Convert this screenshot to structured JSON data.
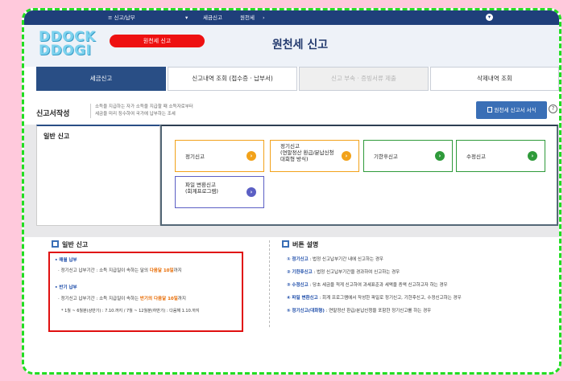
{
  "nav": {
    "menu": "≡ 신고/납부",
    "crumb1": "세금신고",
    "crumb2": "원천세"
  },
  "header": {
    "logo_line1": "DDOCK",
    "logo_line2": "DDOGI",
    "badge": "원천세 신고",
    "title": "원천세 신고"
  },
  "tabs": [
    {
      "label": "세금신고"
    },
    {
      "label": "신고내역 조회 (접수증 · 납부서)"
    },
    {
      "label": "신고 부속 · 증빙서류 제출"
    },
    {
      "label": "삭제내역 조회"
    }
  ],
  "section": {
    "title": "신고서작성",
    "desc1": "소득을 지급하는 자가 소득을 지급할 때 소득자로부터",
    "desc2": "세금을 미리 징수하여 국가에 납부하는 조세",
    "form_button": "원천세 신고서 서식"
  },
  "normal_box": {
    "title": "일반 신고"
  },
  "cards": [
    {
      "label": "정기신고"
    },
    {
      "label_line1": "정기신고",
      "label_line2": "(연말정산 환급/분납신청",
      "label_line3": "대회형 방식)"
    },
    {
      "label": "기한후신고"
    },
    {
      "label": "수정신고"
    },
    {
      "label_line1": "파일 변환신고",
      "label_line2": "(회계프로그램)"
    }
  ],
  "info_left": {
    "heading": "일반 신고",
    "monthly_title": "• 매월 납부",
    "monthly_prefix": "· 정기신고 납부기간 : 소득 지급일이 속하는 달의 ",
    "monthly_highlight": "다음달 10일",
    "monthly_suffix": "까지",
    "half_title": "• 반기 납부",
    "half_prefix": "· 정기신고 납부기간 : 소득 지급일이 속하는 ",
    "half_highlight": "반기의 다음달 10일",
    "half_suffix": "까지",
    "half_note": "* 1월 ~ 6월분(상반기) : 7.10.까지 / 7월 ~ 12월분(하반기) : 다음해 1.10.까지"
  },
  "info_right": {
    "heading": "버튼 설명",
    "items": [
      {
        "num": "①",
        "key": "정기신고",
        "text": " : 법정 신고납부기간 내에 신고하는 경우"
      },
      {
        "num": "②",
        "key": "기한후신고",
        "text": " : 법정 신고납부기간을 경과하여 신고하는 경우"
      },
      {
        "num": "③",
        "key": "수정신고",
        "text": " : 당초 세금을 적게 신고하여 과세표준과 세액을 증액 신고하고자 하는 경우"
      },
      {
        "num": "④",
        "key": "파일 변환신고",
        "text": " : 회계 프로그램에서 작성한 파일로 정기신고, 기한후신고, 수정신고하는 경우"
      },
      {
        "num": "⑤",
        "key": "정기신고(대화형)",
        "text": " : 연말정산 환급/분납신청을 포함한 정기신고를 하는 경우"
      }
    ]
  },
  "colors": {
    "primary": "#294e85",
    "accent_red": "#ee1111",
    "border_green": "#22dd22",
    "orange": "#f2a21a",
    "green": "#2e9a3a",
    "purple": "#5b5fc4"
  }
}
